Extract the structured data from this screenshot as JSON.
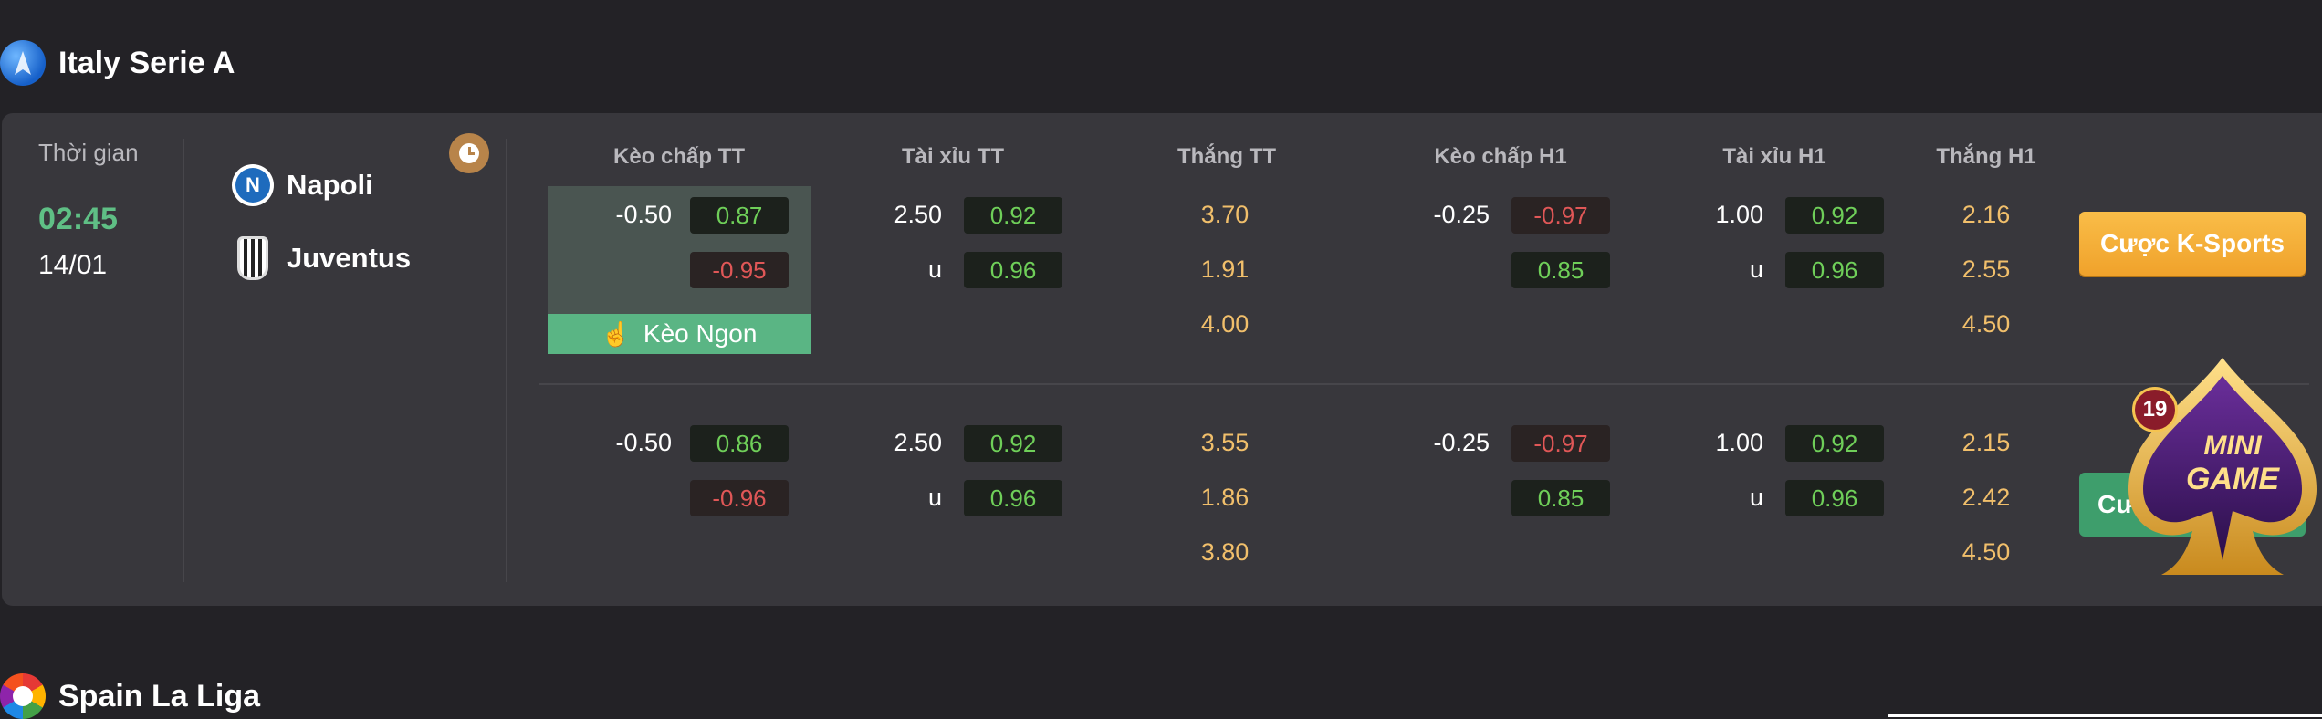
{
  "leagues": [
    {
      "name": "Italy Serie A",
      "logo": "serie-a-logo"
    },
    {
      "name": "Spain La Liga",
      "logo": "laliga-logo"
    }
  ],
  "match": {
    "time_label": "Thời gian",
    "time": "02:45",
    "date": "14/01",
    "home": "Napoli",
    "away": "Juventus"
  },
  "headers": [
    "Kèo chấp TT",
    "Tài xỉu TT",
    "Thắng TT",
    "Kèo chấp H1",
    "Tài xỉu H1",
    "Thắng H1"
  ],
  "rows": [
    {
      "hdp_line": "-0.50",
      "hdp_home": "0.87",
      "hdp_away": "-0.95",
      "ou_line": "2.50",
      "ou_over": "0.92",
      "ou_u": "u",
      "ou_under": "0.96",
      "win": [
        "3.70",
        "1.91",
        "4.00"
      ],
      "h1_line": "-0.25",
      "h1_home": "-0.97",
      "h1_away": "0.85",
      "h1ou_line": "1.00",
      "h1ou_over": "0.92",
      "h1ou_u": "u",
      "h1ou_under": "0.96",
      "h1win": [
        "2.16",
        "2.55",
        "4.50"
      ]
    },
    {
      "hdp_line": "-0.50",
      "hdp_home": "0.86",
      "hdp_away": "-0.96",
      "ou_line": "2.50",
      "ou_over": "0.92",
      "ou_u": "u",
      "ou_under": "0.96",
      "win": [
        "3.55",
        "1.86",
        "3.80"
      ],
      "h1_line": "-0.25",
      "h1_home": "-0.97",
      "h1_away": "0.85",
      "h1ou_line": "1.00",
      "h1ou_over": "0.92",
      "h1ou_u": "u",
      "h1ou_under": "0.96",
      "h1win": [
        "2.15",
        "2.42",
        "4.50"
      ]
    }
  ],
  "keo_ngon": "Kèo Ngon",
  "bet_button": "Cược K-Sports",
  "bet_button_2": "Cư",
  "mini_game": {
    "badge": "19",
    "line1": "MINI",
    "line2": "GAME"
  },
  "colors": {
    "positive": "#6fcf59",
    "negative": "#e05757",
    "win": "#f1bf6b",
    "accent": "#f0a22b",
    "time": "#5fbf85"
  }
}
